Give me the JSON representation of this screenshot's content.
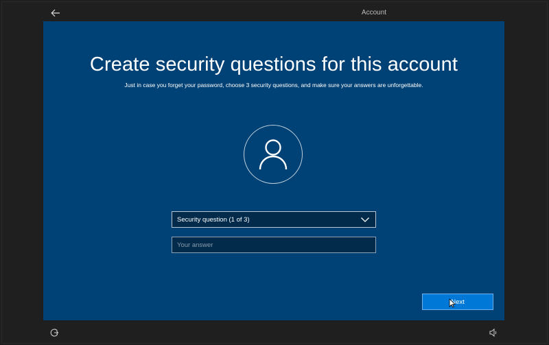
{
  "header": {
    "section_title": "Account"
  },
  "main": {
    "heading": "Create security questions for this account",
    "subheading": "Just in case you forget your password, choose 3 security questions, and make sure your answers are unforgettable.",
    "question_select": {
      "value": "Security question (1 of 3)"
    },
    "answer_input": {
      "placeholder": "Your answer",
      "value": ""
    },
    "next_label": "Next"
  },
  "icons": {
    "back": "arrow-left-icon",
    "avatar": "user-icon",
    "dropdown": "chevron-down-icon",
    "ease_of_access": "ease-of-access-icon",
    "volume": "volume-icon"
  },
  "colors": {
    "background": "#1f1f1f",
    "panel": "#004275",
    "field": "#012a4b",
    "accent": "#0078d7"
  }
}
